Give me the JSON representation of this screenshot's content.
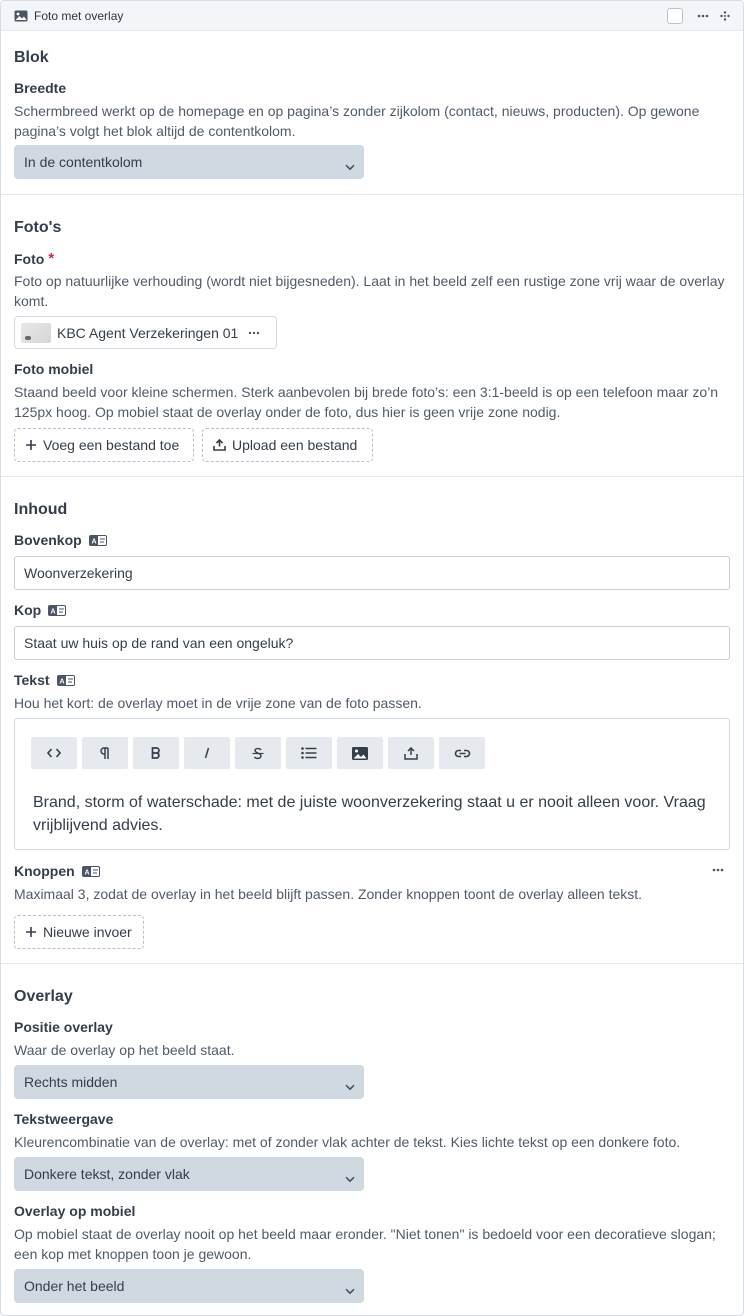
{
  "titlebar": {
    "title": "Foto met overlay"
  },
  "blok": {
    "heading": "Blok",
    "breedte": {
      "label": "Breedte",
      "help": "Schermbreed werkt op de homepage en op pagina’s zonder zijkolom (contact, nieuws, producten). Op gewone pagina’s volgt het blok altijd de contentkolom.",
      "value": "In de contentkolom"
    }
  },
  "fotos": {
    "heading": "Foto's",
    "foto": {
      "label": "Foto",
      "required": "*",
      "help": "Foto op natuurlijke verhouding (wordt niet bijgesneden). Laat in het beeld zelf een rustige zone vrij waar de overlay komt.",
      "file_name": "KBC Agent Verzekeringen 01"
    },
    "foto_mobiel": {
      "label": "Foto mobiel",
      "help": "Staand beeld voor kleine schermen. Sterk aanbevolen bij brede foto’s: een 3:1-beeld is op een telefoon maar zo’n 125px hoog. Op mobiel staat de overlay onder de foto, dus hier is geen vrije zone nodig.",
      "add_label": "Voeg een bestand toe",
      "upload_label": "Upload een bestand"
    }
  },
  "inhoud": {
    "heading": "Inhoud",
    "bovenkop": {
      "label": "Bovenkop",
      "value": "Woonverzekering"
    },
    "kop": {
      "label": "Kop",
      "value": "Staat uw huis op de rand van een ongeluk?"
    },
    "tekst": {
      "label": "Tekst",
      "help": "Hou het kort: de overlay moet in de vrije zone van de foto passen.",
      "toolbar": [
        "<>",
        "¶",
        "B",
        "I",
        "S",
        "list",
        "image",
        "upload",
        "link"
      ],
      "content": "Brand, storm of waterschade: met de juiste woonverzekering staat u er nooit alleen voor. Vraag vrijblijvend advies."
    },
    "knoppen": {
      "label": "Knoppen",
      "help": "Maximaal 3, zodat de overlay in het beeld blijft passen. Zonder knoppen toont de overlay alleen tekst.",
      "new_label": "Nieuwe invoer"
    }
  },
  "overlay": {
    "heading": "Overlay",
    "positie": {
      "label": "Positie overlay",
      "help": "Waar de overlay op het beeld staat.",
      "value": "Rechts midden"
    },
    "tekstweergave": {
      "label": "Tekstweergave",
      "help": "Kleurencombinatie van de overlay: met of zonder vlak achter de tekst. Kies lichte tekst op een donkere foto.",
      "value": "Donkere tekst, zonder vlak"
    },
    "mobiel": {
      "label": "Overlay op mobiel",
      "help": "Op mobiel staat de overlay nooit op het beeld maar eronder. \"Niet tonen\" is bedoeld voor een decoratieve slogan; een kop met knoppen toon je gewoon.",
      "value": "Onder het beeld"
    }
  }
}
